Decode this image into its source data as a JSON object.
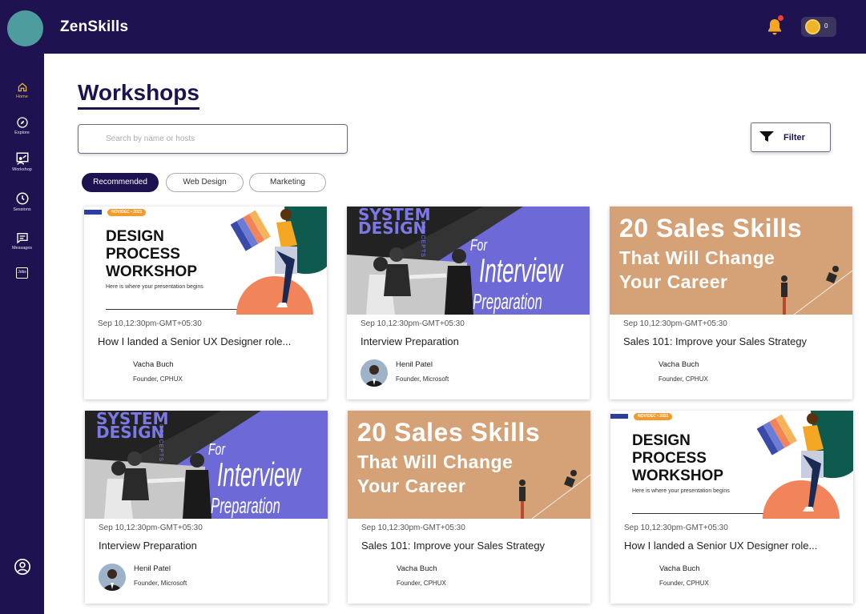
{
  "app": {
    "name": "ZenSkills",
    "coin_count": "0"
  },
  "sidebar": {
    "items": [
      {
        "label": "Home",
        "icon": "home-icon",
        "active": true
      },
      {
        "label": "Explore",
        "icon": "compass-icon"
      },
      {
        "label": "Workshop",
        "icon": "workshop-icon"
      },
      {
        "label": "Sessions",
        "icon": "clock-icon"
      },
      {
        "label": "Messages",
        "icon": "message-icon"
      },
      {
        "label": "Jobs",
        "icon": "jobs-icon"
      }
    ],
    "profile_icon": "user-circle-icon"
  },
  "page": {
    "title": "Workshops"
  },
  "search": {
    "placeholder": "Search by name or hosts"
  },
  "filter": {
    "label": "Filter"
  },
  "chips": [
    "Recommended",
    "Web Design",
    "Marketing"
  ],
  "thumbs": {
    "design_process": {
      "badge": "NOV/DEC • 2021",
      "line1": "DESIGN",
      "line2": "PROCESS",
      "line3": "WORKSHOP",
      "sub": "Here is where your presentation begins"
    },
    "system_design": {
      "line1": "SYSTEM",
      "line2": "DESIGN",
      "side": "CONCEPTS",
      "for": "For",
      "big": "Interview",
      "prep": "Preparation"
    },
    "sales": {
      "line1": "20 Sales Skills",
      "line2": "That Will Change",
      "line3": "Your Career"
    }
  },
  "cards": [
    {
      "thumb": "design_process",
      "date": "Sep 10,12:30pm-GMT+05:30",
      "title": "How I landed a Senior UX Designer role...",
      "host": "Vacha Buch",
      "role": "Founder, CPHUX",
      "photo": false
    },
    {
      "thumb": "system_design",
      "date": "Sep 10,12:30pm-GMT+05:30",
      "title": "Interview Preparation",
      "host": "Henil Patel",
      "role": "Founder, Microsoft",
      "photo": true
    },
    {
      "thumb": "sales",
      "date": "Sep 10,12:30pm-GMT+05:30",
      "title": "Sales 101: Improve your Sales Strategy",
      "host": "Vacha Buch",
      "role": "Founder, CPHUX",
      "photo": false
    },
    {
      "thumb": "system_design",
      "date": "Sep 10,12:30pm-GMT+05:30",
      "title": "Interview Preparation",
      "host": "Henil Patel",
      "role": "Founder, Microsoft",
      "photo": true
    },
    {
      "thumb": "sales",
      "date": "Sep 10,12:30pm-GMT+05:30",
      "title": "Sales 101: Improve your Sales Strategy",
      "host": "Vacha Buch",
      "role": "Founder, CPHUX",
      "photo": false
    },
    {
      "thumb": "design_process",
      "date": "Sep 10,12:30pm-GMT+05:30",
      "title": "How I landed a Senior UX Designer role...",
      "host": "Vacha Buch",
      "role": "Founder, CPHUX",
      "photo": false
    }
  ],
  "colors": {
    "brand": "#1e1250",
    "accent": "#f5c24b",
    "purple": "#6d6ad8",
    "tan": "#d4a276"
  }
}
